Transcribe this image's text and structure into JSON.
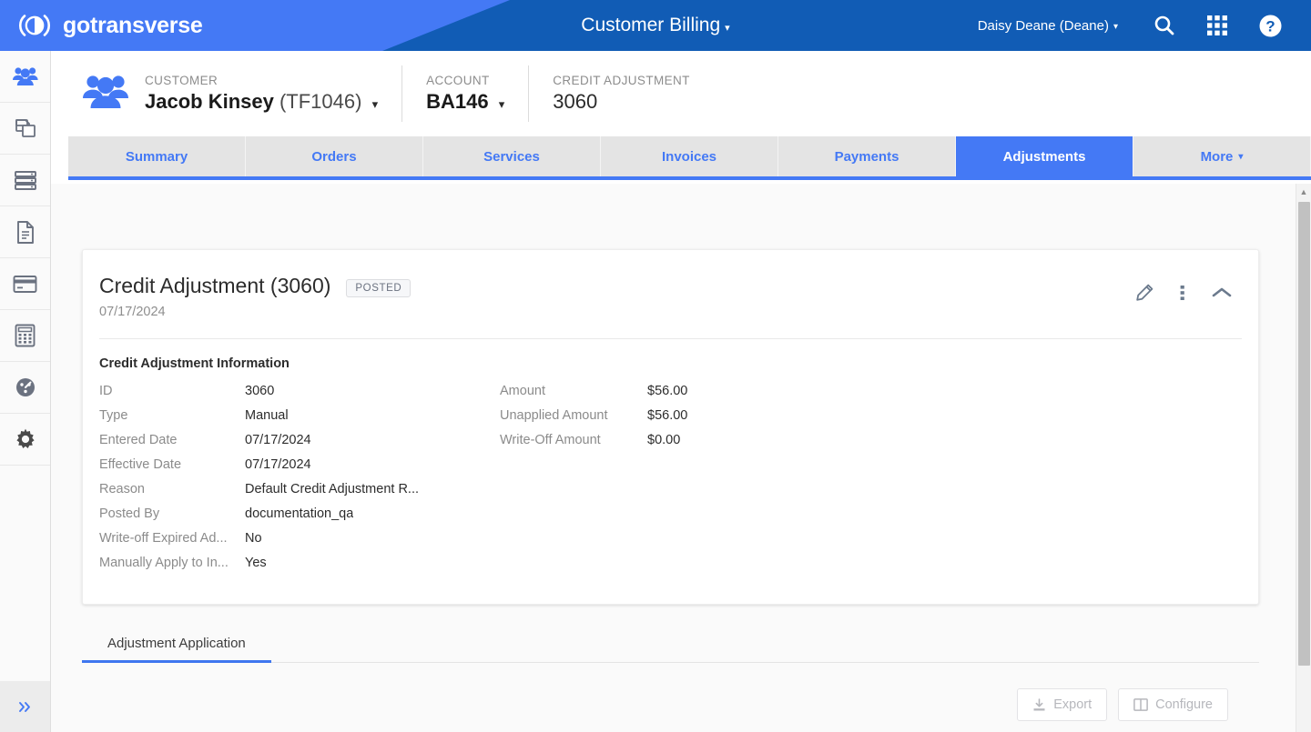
{
  "header": {
    "logo_text": "gotransverse",
    "logo_icon": "gotransverse-circle-logo-icon",
    "app_title": "Customer Billing",
    "app_title_caret": "▾",
    "user_name": "Daisy Deane (Deane)",
    "user_caret": "▾",
    "icons": [
      {
        "name": "search-icon"
      },
      {
        "name": "apps-grid-icon"
      },
      {
        "name": "help-icon"
      }
    ],
    "colors": {
      "wedge": "#4479f5",
      "base": "#115cb5"
    }
  },
  "sidebar": {
    "items": [
      {
        "name": "sidebar-item-customers",
        "icon": "customers-group-icon",
        "active": true
      },
      {
        "name": "sidebar-item-products",
        "icon": "copy-pages-icon",
        "active": false
      },
      {
        "name": "sidebar-item-rating",
        "icon": "server-stack-icon",
        "active": false
      },
      {
        "name": "sidebar-item-documents",
        "icon": "document-icon",
        "active": false
      },
      {
        "name": "sidebar-item-payments",
        "icon": "credit-card-icon",
        "active": false
      },
      {
        "name": "sidebar-item-calculator",
        "icon": "calculator-icon",
        "active": false
      },
      {
        "name": "sidebar-item-dashboard",
        "icon": "gauge-icon",
        "active": false
      },
      {
        "name": "sidebar-item-settings",
        "icon": "gear-icon",
        "active": false
      }
    ],
    "collapse_icon": "double-chevron-right-icon"
  },
  "breadcrumb": {
    "icon": "customers-group-icon",
    "customer": {
      "label": "CUSTOMER",
      "name": "Jacob Kinsey",
      "code": "(TF1046)",
      "caret": "▾"
    },
    "account": {
      "label": "ACCOUNT",
      "value": "BA146",
      "caret": "▾"
    },
    "credit_adjustment": {
      "label": "CREDIT ADJUSTMENT",
      "value": "3060"
    }
  },
  "tabs": [
    {
      "label": "Summary",
      "active": false
    },
    {
      "label": "Orders",
      "active": false
    },
    {
      "label": "Services",
      "active": false
    },
    {
      "label": "Invoices",
      "active": false
    },
    {
      "label": "Payments",
      "active": false
    },
    {
      "label": "Adjustments",
      "active": true
    },
    {
      "label": "More",
      "active": false,
      "caret": "▾"
    }
  ],
  "card": {
    "title": "Credit Adjustment (3060)",
    "badge": "POSTED",
    "date": "07/17/2024",
    "actions": [
      {
        "name": "edit-pencil-icon"
      },
      {
        "name": "more-vertical-icon"
      },
      {
        "name": "collapse-chevron-up-icon"
      }
    ],
    "section_title": "Credit Adjustment Information",
    "fields_left": [
      {
        "label": "ID",
        "value": "3060"
      },
      {
        "label": "Type",
        "value": "Manual"
      },
      {
        "label": "Entered Date",
        "value": "07/17/2024"
      },
      {
        "label": "Effective Date",
        "value": "07/17/2024"
      },
      {
        "label": "Reason",
        "value": "Default Credit Adjustment R..."
      },
      {
        "label": "Posted By",
        "value": "documentation_qa"
      },
      {
        "label": "Write-off Expired Ad...",
        "value": "No"
      },
      {
        "label": "Manually Apply to In...",
        "value": "Yes"
      }
    ],
    "fields_right": [
      {
        "label": "Amount",
        "value": "$56.00"
      },
      {
        "label": "Unapplied Amount",
        "value": "$56.00"
      },
      {
        "label": "Write-Off Amount",
        "value": "$0.00"
      }
    ]
  },
  "subtabs": [
    {
      "label": "Adjustment Application",
      "active": true
    }
  ],
  "grid_toolbar": {
    "export_label": "Export",
    "export_icon": "download-icon",
    "configure_label": "Configure",
    "configure_icon": "columns-icon"
  },
  "scrollbar": {
    "up_arrow": "▲"
  }
}
